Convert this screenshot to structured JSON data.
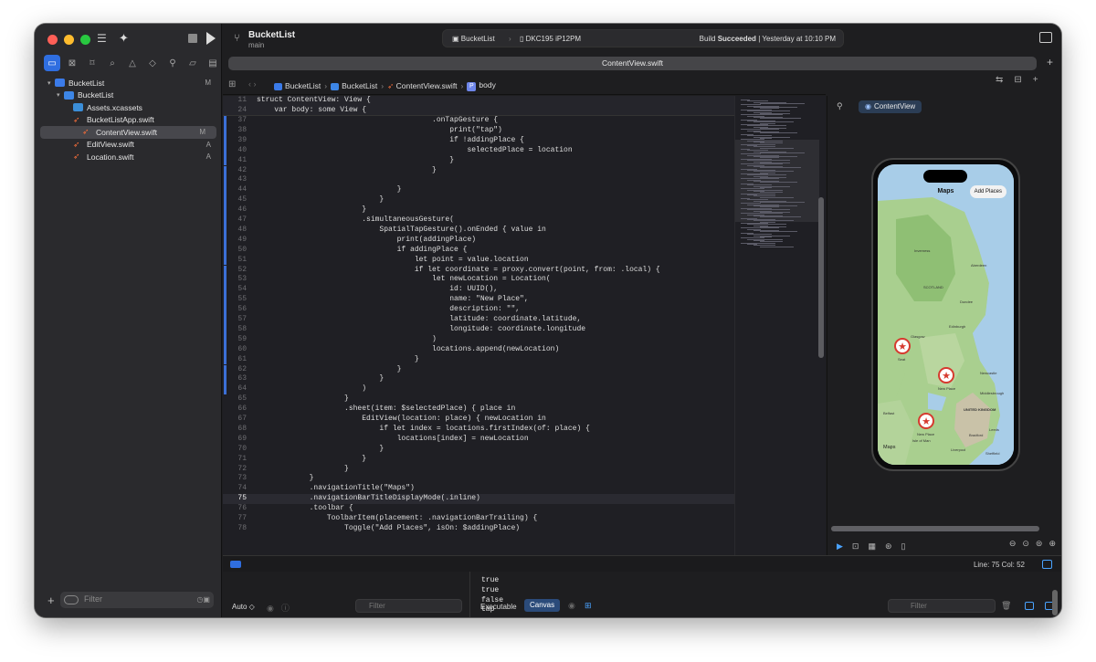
{
  "toolbar": {
    "project": "BucketList",
    "branch": "main",
    "scheme": "BucketList",
    "device": "DKC195 iP12PM",
    "status_prefix": "Build",
    "status_bold": "Succeeded",
    "status_suffix": "| Yesterday at 10:10 PM"
  },
  "tab": {
    "active": "ContentView.swift"
  },
  "navigator": {
    "items": [
      {
        "label": "BucketList",
        "badge": "M",
        "indent": 0,
        "kind": "proj",
        "chev": "▾"
      },
      {
        "label": "BucketList",
        "badge": "",
        "indent": 1,
        "kind": "folder",
        "chev": "▾"
      },
      {
        "label": "Assets.xcassets",
        "badge": "",
        "indent": 2,
        "kind": "assets",
        "chev": ""
      },
      {
        "label": "BucketListApp.swift",
        "badge": "",
        "indent": 2,
        "kind": "swift",
        "chev": ""
      },
      {
        "label": "ContentView.swift",
        "badge": "M",
        "indent": 2,
        "kind": "swift",
        "chev": "",
        "selected": true
      },
      {
        "label": "EditView.swift",
        "badge": "A",
        "indent": 2,
        "kind": "swift",
        "chev": ""
      },
      {
        "label": "Location.swift",
        "badge": "A",
        "indent": 2,
        "kind": "swift",
        "chev": ""
      }
    ],
    "filter_placeholder": "Filter"
  },
  "jumpbar": [
    "BucketList",
    "BucketList",
    "ContentView.swift",
    "body"
  ],
  "editor": {
    "sticky": [
      {
        "n": "11",
        "code": "struct ContentView: View {"
      },
      {
        "n": "24",
        "code": "    var body: some View {"
      }
    ],
    "lines": [
      {
        "n": "37",
        "code": "                                        .onTapGesture {"
      },
      {
        "n": "38",
        "code": "                                            print(\"tap\")"
      },
      {
        "n": "39",
        "code": "                                            if !addingPlace {"
      },
      {
        "n": "40",
        "code": "                                                selectedPlace = location"
      },
      {
        "n": "41",
        "code": "                                            }"
      },
      {
        "n": "42",
        "code": "                                        }"
      },
      {
        "n": "43",
        "code": "                                "
      },
      {
        "n": "44",
        "code": "                                }"
      },
      {
        "n": "45",
        "code": "                            }"
      },
      {
        "n": "46",
        "code": "                        }"
      },
      {
        "n": "47",
        "code": "                        .simultaneousGesture("
      },
      {
        "n": "48",
        "code": "                            SpatialTapGesture().onEnded { value in"
      },
      {
        "n": "49",
        "code": "                                print(addingPlace)"
      },
      {
        "n": "50",
        "code": "                                if addingPlace {"
      },
      {
        "n": "51",
        "code": "                                    let point = value.location"
      },
      {
        "n": "52",
        "code": "                                    if let coordinate = proxy.convert(point, from: .local) {"
      },
      {
        "n": "53",
        "code": "                                        let newLocation = Location("
      },
      {
        "n": "54",
        "code": "                                            id: UUID(),"
      },
      {
        "n": "55",
        "code": "                                            name: \"New Place\","
      },
      {
        "n": "56",
        "code": "                                            description: \"\","
      },
      {
        "n": "57",
        "code": "                                            latitude: coordinate.latitude,"
      },
      {
        "n": "58",
        "code": "                                            longitude: coordinate.longitude"
      },
      {
        "n": "59",
        "code": "                                        )"
      },
      {
        "n": "60",
        "code": "                                        locations.append(newLocation)"
      },
      {
        "n": "61",
        "code": "                                    }"
      },
      {
        "n": "62",
        "code": "                                }"
      },
      {
        "n": "63",
        "code": "                            }"
      },
      {
        "n": "64",
        "code": "                        )"
      },
      {
        "n": "65",
        "code": "                    }"
      },
      {
        "n": "66",
        "code": "                    .sheet(item: $selectedPlace) { place in"
      },
      {
        "n": "67",
        "code": "                        EditView(location: place) { newLocation in"
      },
      {
        "n": "68",
        "code": "                            if let index = locations.firstIndex(of: place) {"
      },
      {
        "n": "69",
        "code": "                                locations[index] = newLocation"
      },
      {
        "n": "70",
        "code": "                            }"
      },
      {
        "n": "71",
        "code": "                        }"
      },
      {
        "n": "72",
        "code": "                    }"
      },
      {
        "n": "73",
        "code": "            }"
      },
      {
        "n": "74",
        "code": "            .navigationTitle(\"Maps\")"
      },
      {
        "n": "75",
        "code": "            .navigationBarTitleDisplayMode(.inline)",
        "current": true
      },
      {
        "n": "76",
        "code": "            .toolbar {"
      },
      {
        "n": "77",
        "code": "                ToolbarItem(placement: .navigationBarTrailing) {"
      },
      {
        "n": "78",
        "code": "                    Toggle(\"Add Places\", isOn: $addingPlace)"
      }
    ]
  },
  "canvas": {
    "preview_name": "ContentView",
    "map_title": "Maps",
    "add_button": "Add Places",
    "maps_logo": "Maps",
    "labels": [
      {
        "text": "SCOTLAND"
      },
      {
        "text": "Inverness"
      },
      {
        "text": "Aberdeen"
      },
      {
        "text": "Dundee"
      },
      {
        "text": "Edinburgh"
      },
      {
        "text": "Glasgow"
      },
      {
        "text": "Newcastle"
      },
      {
        "text": "UNITED KINGDOM"
      },
      {
        "text": "Leeds"
      },
      {
        "text": "Bradford"
      },
      {
        "text": "Liverpool"
      },
      {
        "text": "Sheffield"
      },
      {
        "text": "Belfast"
      },
      {
        "text": "Isle of Man"
      },
      {
        "text": "Middlesbrough"
      }
    ],
    "pins": [
      {
        "label": "Seat"
      },
      {
        "label": "New Place"
      },
      {
        "label": "New Place"
      }
    ]
  },
  "status": {
    "position": "Line: 75  Col: 52"
  },
  "debug": {
    "scope": "Auto ◇",
    "filter": "Filter",
    "console": [
      "true",
      "true",
      "false",
      "tap"
    ],
    "executable": "Executable",
    "canvas": "Canvas",
    "filter_right": "Filter"
  },
  "colors": {
    "accent": "#2f6ee0",
    "keyword": "#fc5fa3",
    "string": "#fc6a5d",
    "pin": "#d63a2f"
  }
}
